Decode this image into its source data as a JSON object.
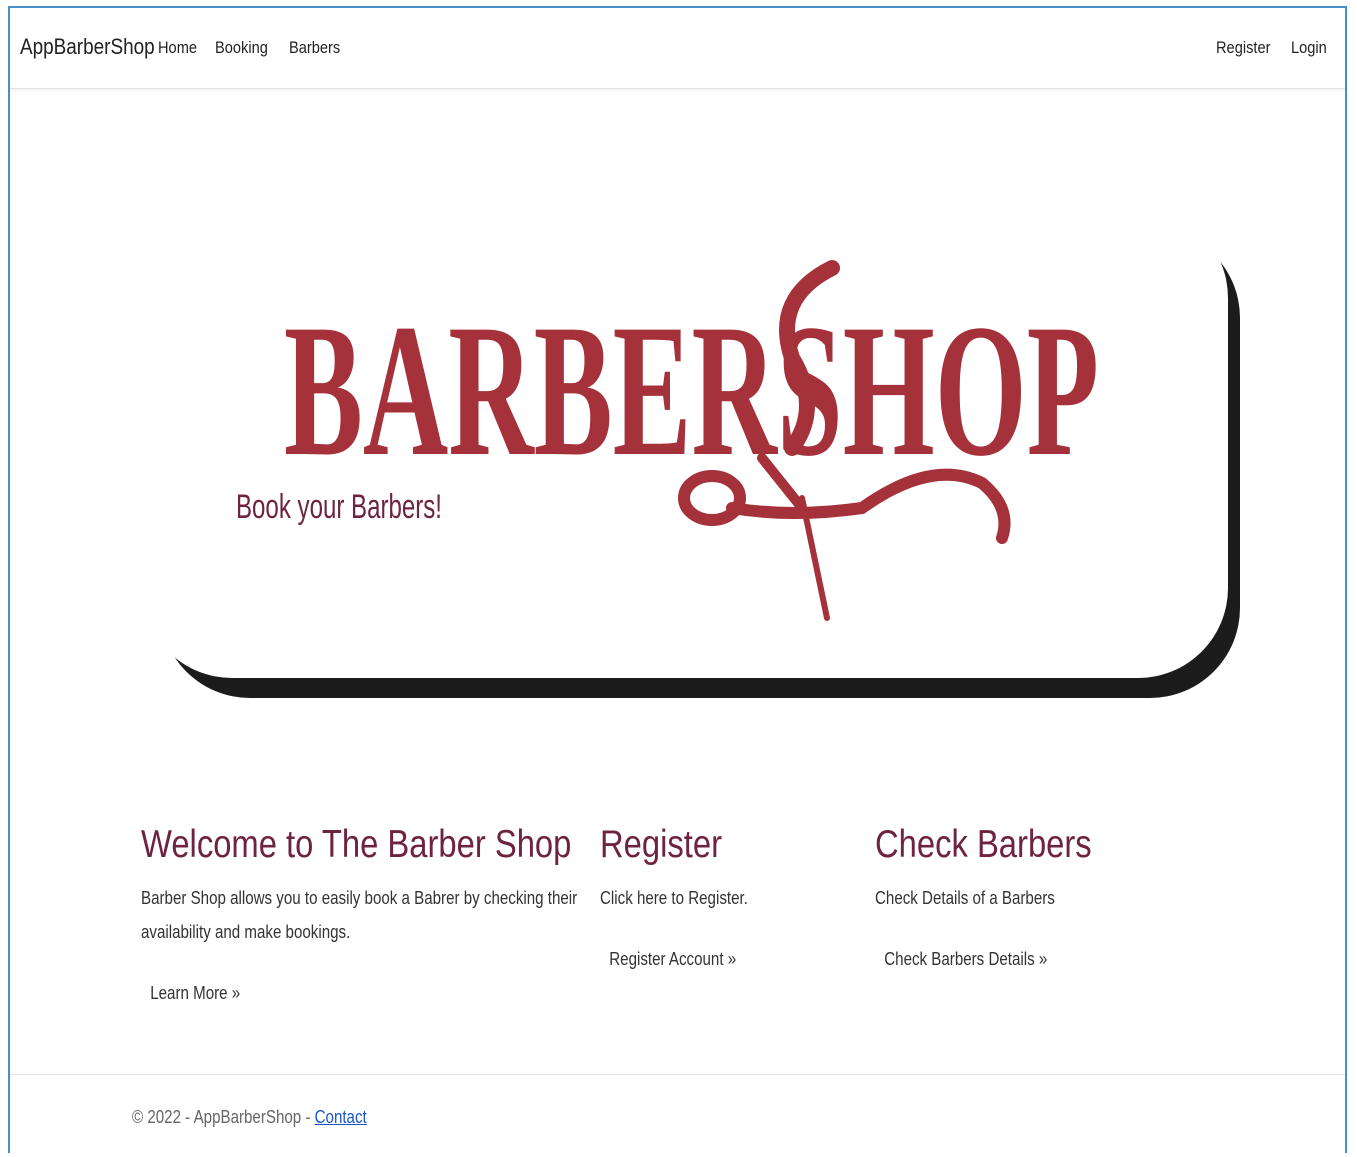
{
  "nav": {
    "brand": "AppBarberShop",
    "left_links": [
      "Home",
      "Booking",
      "Barbers"
    ],
    "right_links": [
      "Register",
      "Login"
    ]
  },
  "hero": {
    "logo_text": "BARBERSHOP",
    "tagline": "Book your Barbers!",
    "accent_color": "#a5323a",
    "tagline_color": "#6e2440"
  },
  "columns": [
    {
      "heading": "Welcome to The Barber Shop",
      "text_lines": [
        "Barber Shop allows you to easily book a Babrer by checking their",
        "availability and make bookings."
      ],
      "link": "Learn More »"
    },
    {
      "heading": "Register",
      "text_lines": [
        "Click here to Register."
      ],
      "link": "Register Account »"
    },
    {
      "heading": "Check Barbers",
      "text_lines": [
        "Check Details of a Barbers"
      ],
      "link": "Check Barbers Details »"
    }
  ],
  "footer": {
    "text": "© 2022 - AppBarberShop - ",
    "link": "Contact"
  }
}
